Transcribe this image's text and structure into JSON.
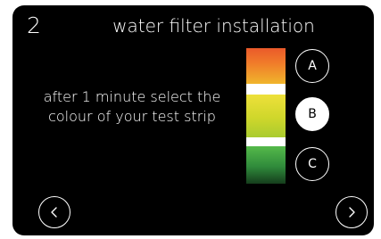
{
  "header": {
    "step_number": "2",
    "title": "water filter installation"
  },
  "instruction": {
    "line1": "after 1 minute select the",
    "line2": "colour of your test strip"
  },
  "test_strip": {
    "bands": [
      {
        "name": "A",
        "color_top": "#ea5a2a",
        "color_bottom": "#f0b52c"
      },
      {
        "name": "B",
        "color_top": "#eee03a",
        "color_bottom": "#a9cb2f"
      },
      {
        "name": "C",
        "color_top": "#55b94a",
        "color_bottom": "#153d1c"
      }
    ]
  },
  "options": [
    {
      "label": "A",
      "selected": false
    },
    {
      "label": "B",
      "selected": true
    },
    {
      "label": "C",
      "selected": false
    }
  ],
  "navigation": {
    "back_icon": "chevron-left-icon",
    "next_icon": "chevron-right-icon"
  },
  "colors": {
    "background": "#000000",
    "foreground": "#ffffff",
    "selected_fill": "#ffffff"
  }
}
